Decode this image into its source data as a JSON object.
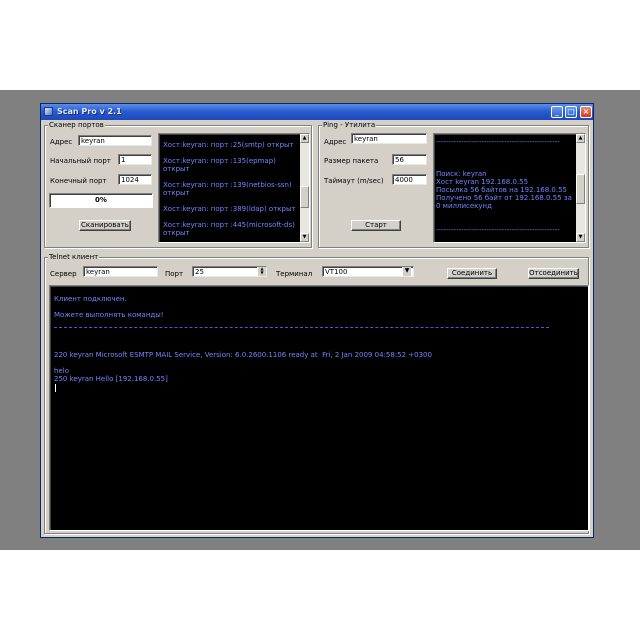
{
  "window": {
    "title": "Scan Pro v 2.1"
  },
  "scanner": {
    "group_title": "Сканер портов",
    "address_label": "Адрес",
    "address_value": "keyran",
    "start_port_label": "Начальный порт",
    "start_port_value": "1",
    "end_port_label": "Конечный порт",
    "end_port_value": "1024",
    "progress_text": "0%",
    "progress": 0,
    "scan_button": "Сканировать",
    "results": [
      "Хост:keyran: порт :25(smtp) открыт",
      "",
      "Хост:keyran: порт :135(epmap)",
      "открыт",
      "",
      "Хост:keyran: порт :139(netbios-ssn)",
      "открыт",
      "",
      "Хост:keyran: порт :389(ldap) открыт",
      "",
      "Хост:keyran: порт :445(microsoft-ds)",
      "открыт"
    ]
  },
  "ping": {
    "group_title": "Ping - Утилита",
    "address_label": "Адрес",
    "address_value": "keyran",
    "packet_size_label": "Размер пакета",
    "packet_size_value": "56",
    "timeout_label": "Таймаут (m/sec)",
    "timeout_value": "4000",
    "start_button": "Старт",
    "output": [
      "-------------------------------------------------",
      "",
      "",
      "",
      "Поиск: keyran",
      "Хост keyran 192.168.0.55",
      "Посылка 56 байтов на 192.168.0.55",
      "Получено 56 байт от 192.168.0.55 за",
      "0 миллисекунд",
      "",
      "",
      "-------------------------------------------------"
    ]
  },
  "telnet": {
    "group_title": "Telnet клиент",
    "server_label": "Сервер",
    "server_value": "keyran",
    "port_label": "Порт",
    "port_value": "25",
    "terminal_label": "Терминал",
    "terminal_value": "VT100",
    "connect_button": "Соединить",
    "disconnect_button": "Отсоединить",
    "console_lines": [
      "Клиент подключен.",
      "",
      "Можете выполнять команды!",
      "",
      "",
      "",
      "220 keyran Microsoft ESMTP MAIL Service, Version: 6.0.2600.1106 ready at  Fri, 2 Jan 2009 04:58:52 +0300",
      "",
      "helo",
      "250 keyran Hello [192.168.0.55]"
    ]
  },
  "colors": {
    "console_text": "#6f86ff",
    "console_bg": "#000000",
    "titlebar": "#2a5cd0"
  }
}
